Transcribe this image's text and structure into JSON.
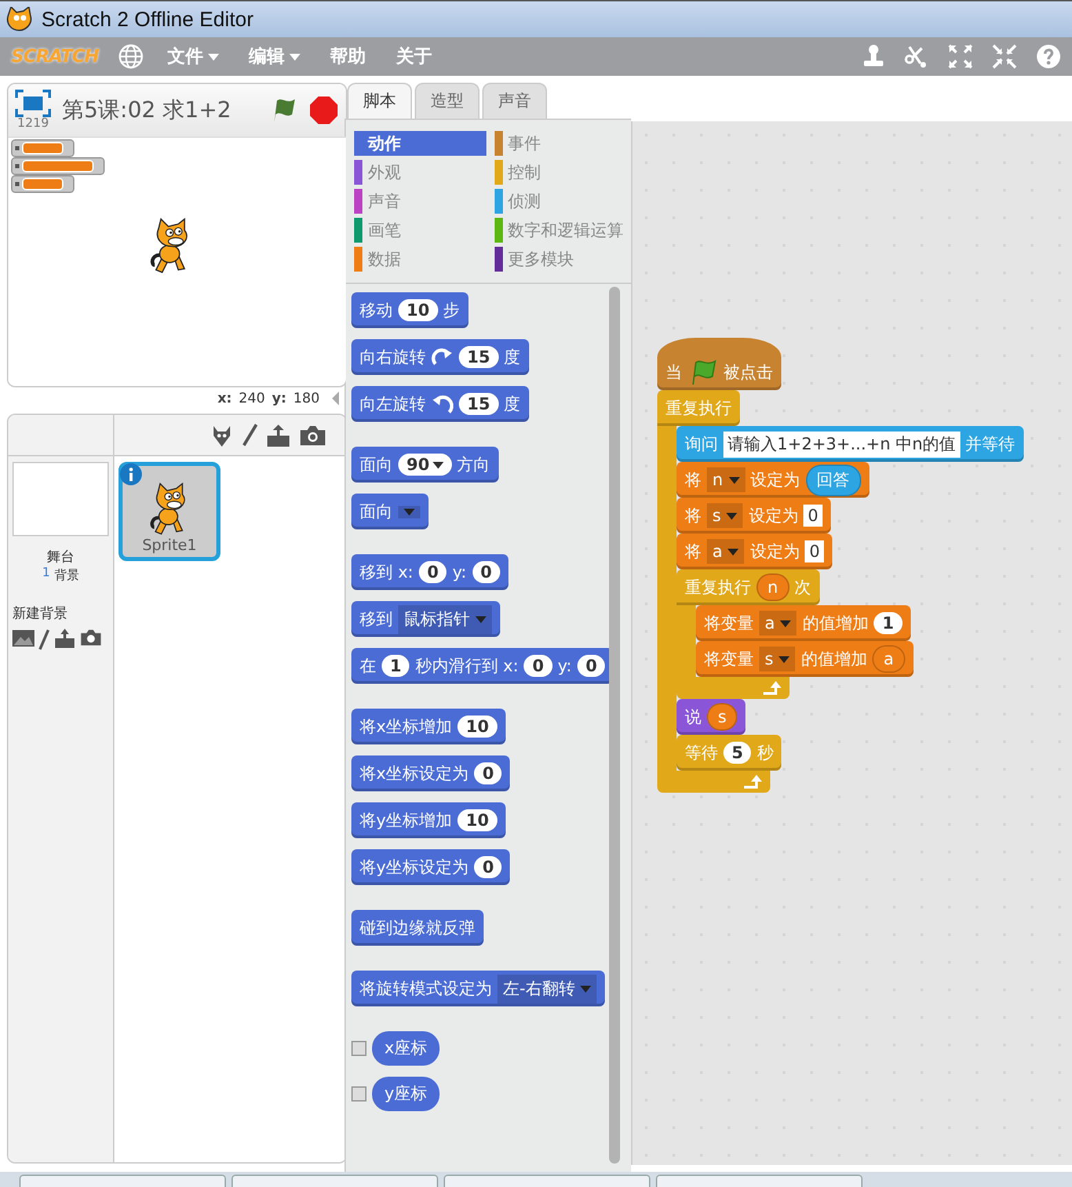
{
  "window": {
    "title": "Scratch 2 Offline Editor"
  },
  "menu_bar": {
    "logo": "SCRATCH",
    "items": [
      {
        "label": "文件",
        "has_menu": true
      },
      {
        "label": "编辑",
        "has_menu": true
      },
      {
        "label": "帮助",
        "has_menu": false
      },
      {
        "label": "关于",
        "has_menu": false
      }
    ]
  },
  "stage": {
    "size_label": "1219",
    "title": "第5课:02 求1+2",
    "x_label": "x:",
    "x_value": "240",
    "y_label": "y:",
    "y_value": "180"
  },
  "sprites_pane": {
    "stage_name": "舞台",
    "backdrop_count": "1",
    "backdrop_label": "背景",
    "new_backdrop": "新建背景",
    "sprites": [
      {
        "name": "Sprite1",
        "selected": true
      }
    ]
  },
  "tabs": [
    {
      "label": "脚本",
      "selected": true
    },
    {
      "label": "造型",
      "selected": false
    },
    {
      "label": "声音",
      "selected": false
    }
  ],
  "categories": [
    {
      "label": "动作",
      "color": "#4a6cd4",
      "selected": true
    },
    {
      "label": "事件",
      "color": "#c88330",
      "selected": false
    },
    {
      "label": "外观",
      "color": "#8a55d7",
      "selected": false
    },
    {
      "label": "控制",
      "color": "#e1a91a",
      "selected": false
    },
    {
      "label": "声音",
      "color": "#bb42c3",
      "selected": false
    },
    {
      "label": "侦测",
      "color": "#2ca5e2",
      "selected": false
    },
    {
      "label": "画笔",
      "color": "#0e9a6c",
      "selected": false
    },
    {
      "label": "数字和逻辑运算",
      "color": "#5cb712",
      "selected": false
    },
    {
      "label": "数据",
      "color": "#ee7d16",
      "selected": false
    },
    {
      "label": "更多模块",
      "color": "#632d99",
      "selected": false
    }
  ],
  "palette": {
    "groups": [
      [
        {
          "color": "#4a6cd4",
          "parts": [
            {
              "kind": "label",
              "text": "移动"
            },
            {
              "kind": "number",
              "text": "10"
            },
            {
              "kind": "label",
              "text": "步"
            }
          ]
        },
        {
          "color": "#4a6cd4",
          "parts": [
            {
              "kind": "label",
              "text": "向右旋转"
            },
            {
              "kind": "turn_right"
            },
            {
              "kind": "number",
              "text": "15"
            },
            {
              "kind": "label",
              "text": "度"
            }
          ]
        },
        {
          "color": "#4a6cd4",
          "parts": [
            {
              "kind": "label",
              "text": "向左旋转"
            },
            {
              "kind": "turn_left"
            },
            {
              "kind": "number",
              "text": "15"
            },
            {
              "kind": "label",
              "text": "度"
            }
          ]
        }
      ],
      [
        {
          "color": "#4a6cd4",
          "parts": [
            {
              "kind": "label",
              "text": "面向"
            },
            {
              "kind": "numdrop",
              "text": "90"
            },
            {
              "kind": "label",
              "text": "方向"
            }
          ]
        },
        {
          "color": "#4a6cd4",
          "parts": [
            {
              "kind": "label",
              "text": "面向"
            },
            {
              "kind": "menu"
            }
          ]
        }
      ],
      [
        {
          "color": "#4a6cd4",
          "parts": [
            {
              "kind": "label",
              "text": "移到 x:"
            },
            {
              "kind": "number",
              "text": "0"
            },
            {
              "kind": "label",
              "text": "y:"
            },
            {
              "kind": "number",
              "text": "0"
            }
          ]
        },
        {
          "color": "#4a6cd4",
          "parts": [
            {
              "kind": "label",
              "text": "移到"
            },
            {
              "kind": "dropdown",
              "text": "鼠标指针"
            }
          ]
        },
        {
          "color": "#4a6cd4",
          "parts": [
            {
              "kind": "label",
              "text": "在"
            },
            {
              "kind": "number",
              "text": "1"
            },
            {
              "kind": "label",
              "text": "秒内滑行到 x:"
            },
            {
              "kind": "number",
              "text": "0"
            },
            {
              "kind": "label",
              "text": "y:"
            },
            {
              "kind": "number",
              "text": "0"
            }
          ]
        }
      ],
      [
        {
          "color": "#4a6cd4",
          "parts": [
            {
              "kind": "label",
              "text": "将x坐标增加"
            },
            {
              "kind": "number",
              "text": "10"
            }
          ]
        },
        {
          "color": "#4a6cd4",
          "parts": [
            {
              "kind": "label",
              "text": "将x坐标设定为"
            },
            {
              "kind": "number",
              "text": "0"
            }
          ]
        },
        {
          "color": "#4a6cd4",
          "parts": [
            {
              "kind": "label",
              "text": "将y坐标增加"
            },
            {
              "kind": "number",
              "text": "10"
            }
          ]
        },
        {
          "color": "#4a6cd4",
          "parts": [
            {
              "kind": "label",
              "text": "将y坐标设定为"
            },
            {
              "kind": "number",
              "text": "0"
            }
          ]
        }
      ],
      [
        {
          "color": "#4a6cd4",
          "parts": [
            {
              "kind": "label",
              "text": "碰到边缘就反弹"
            }
          ]
        }
      ],
      [
        {
          "color": "#4a6cd4",
          "parts": [
            {
              "kind": "label",
              "text": "将旋转模式设定为"
            },
            {
              "kind": "dropdown",
              "text": "左-右翻转"
            }
          ]
        }
      ]
    ],
    "reporters": [
      {
        "color": "#4a6cd4",
        "label": "x座标",
        "checked": false
      },
      {
        "color": "#4a6cd4",
        "label": "y座标",
        "checked": false
      }
    ]
  },
  "script": {
    "blocks": [
      {
        "kind": "hat",
        "color": "#c88330",
        "parts": [
          {
            "kind": "label",
            "text": "当"
          },
          {
            "kind": "flag"
          },
          {
            "kind": "label",
            "text": "被点击"
          }
        ]
      },
      {
        "kind": "c",
        "color": "#e1a91a",
        "parts": [
          {
            "kind": "label",
            "text": "重复执行"
          }
        ],
        "children": [
          {
            "kind": "stack",
            "color": "#2ca5e2",
            "parts": [
              {
                "kind": "label",
                "text": "询问"
              },
              {
                "kind": "string",
                "text": "请输入1+2+3+...+n   中n的值"
              },
              {
                "kind": "label",
                "text": "并等待"
              }
            ]
          },
          {
            "kind": "stack",
            "color": "#ee7d16",
            "parts": [
              {
                "kind": "label",
                "text": "将"
              },
              {
                "kind": "dropdown",
                "text": "n"
              },
              {
                "kind": "label",
                "text": "设定为"
              },
              {
                "kind": "reporter",
                "color": "#2ca5e2",
                "text": "回答"
              }
            ]
          },
          {
            "kind": "stack",
            "color": "#ee7d16",
            "parts": [
              {
                "kind": "label",
                "text": "将"
              },
              {
                "kind": "dropdown",
                "text": "s"
              },
              {
                "kind": "label",
                "text": "设定为"
              },
              {
                "kind": "string",
                "text": "0"
              }
            ]
          },
          {
            "kind": "stack",
            "color": "#ee7d16",
            "parts": [
              {
                "kind": "label",
                "text": "将"
              },
              {
                "kind": "dropdown",
                "text": "a"
              },
              {
                "kind": "label",
                "text": "设定为"
              },
              {
                "kind": "string",
                "text": "0"
              }
            ]
          },
          {
            "kind": "c",
            "color": "#e1a91a",
            "parts": [
              {
                "kind": "label",
                "text": "重复执行"
              },
              {
                "kind": "reporter",
                "color": "#ee7d16",
                "text": "n"
              },
              {
                "kind": "label",
                "text": "次"
              }
            ],
            "children": [
              {
                "kind": "stack",
                "color": "#ee7d16",
                "parts": [
                  {
                    "kind": "label",
                    "text": "将变量"
                  },
                  {
                    "kind": "dropdown",
                    "text": "a"
                  },
                  {
                    "kind": "label",
                    "text": "的值增加"
                  },
                  {
                    "kind": "number",
                    "text": "1"
                  }
                ]
              },
              {
                "kind": "stack",
                "color": "#ee7d16",
                "parts": [
                  {
                    "kind": "label",
                    "text": "将变量"
                  },
                  {
                    "kind": "dropdown",
                    "text": "s"
                  },
                  {
                    "kind": "label",
                    "text": "的值增加"
                  },
                  {
                    "kind": "reporter",
                    "color": "#ee7d16",
                    "text": "a"
                  }
                ]
              }
            ]
          },
          {
            "kind": "stack",
            "color": "#8a55d7",
            "parts": [
              {
                "kind": "label",
                "text": "说"
              },
              {
                "kind": "reporter",
                "color": "#ee7d16",
                "text": "s"
              }
            ]
          },
          {
            "kind": "stack",
            "color": "#e1a91a",
            "parts": [
              {
                "kind": "label",
                "text": "等待"
              },
              {
                "kind": "number",
                "text": "5"
              },
              {
                "kind": "label",
                "text": "秒"
              }
            ]
          }
        ]
      }
    ]
  }
}
